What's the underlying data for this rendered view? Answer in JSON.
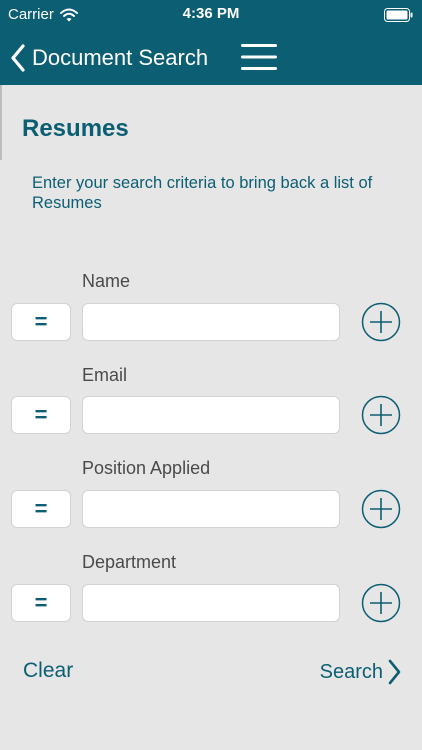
{
  "status_bar": {
    "carrier": "Carrier",
    "time": "4:36 PM"
  },
  "nav": {
    "back_label": "Document Search"
  },
  "page": {
    "title": "Resumes",
    "subtitle": "Enter your search criteria to bring back a list of Resumes"
  },
  "fields": [
    {
      "label": "Name",
      "operator": "=",
      "value": ""
    },
    {
      "label": "Email",
      "operator": "=",
      "value": ""
    },
    {
      "label": "Position Applied",
      "operator": "=",
      "value": ""
    },
    {
      "label": "Department",
      "operator": "=",
      "value": ""
    }
  ],
  "actions": {
    "clear_label": "Clear",
    "search_label": "Search"
  },
  "colors": {
    "brand": "#0c5e73",
    "background": "#e6e6e6",
    "input_border": "#d3d3d3"
  },
  "icons": [
    "wifi-icon",
    "battery-icon",
    "chevron-left-icon",
    "hamburger-menu-icon",
    "plus-circle-icon",
    "chevron-right-icon"
  ]
}
